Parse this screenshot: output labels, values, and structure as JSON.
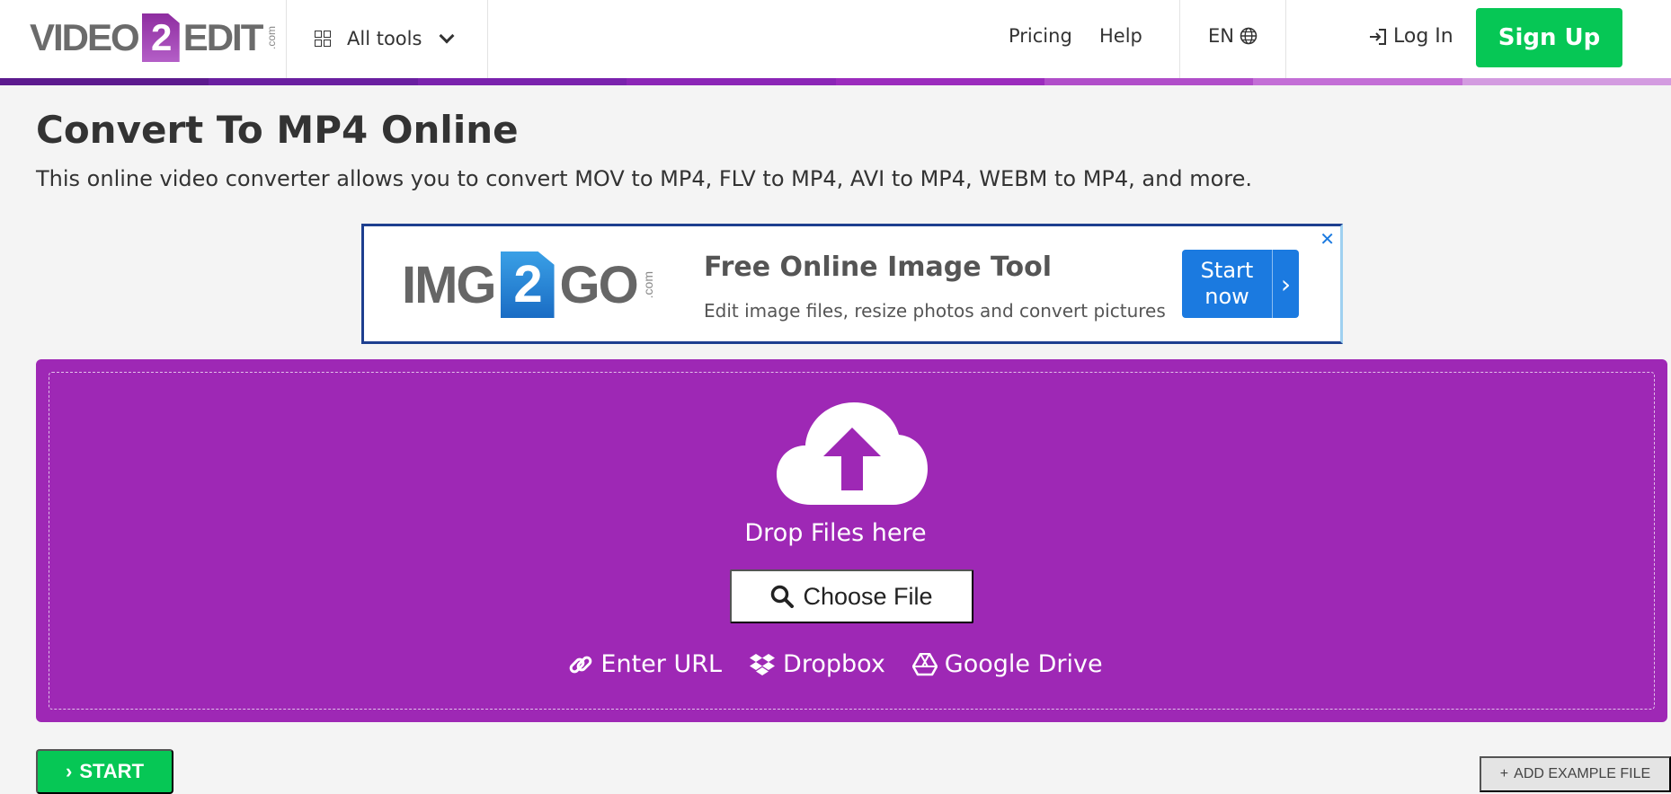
{
  "header": {
    "logo": {
      "left": "VIDEO",
      "two": "2",
      "right": "EDIT",
      "com": ".com"
    },
    "all_tools": "All tools",
    "pricing": "Pricing",
    "help": "Help",
    "lang": "EN",
    "login": "Log In",
    "signup": "Sign Up"
  },
  "page": {
    "title": "Convert To MP4 Online",
    "subtitle": "This online video converter allows you to convert MOV to MP4, FLV to MP4, AVI to MP4, WEBM to MP4, and more."
  },
  "ad": {
    "logo": {
      "left": "IMG",
      "two": "2",
      "right": "GO",
      "com": ".com"
    },
    "heading": "Free Online Image Tool",
    "text": "Edit image files, resize photos and convert pictures",
    "button": "Start now",
    "close": "✕"
  },
  "dropzone": {
    "drop_text": "Drop Files here",
    "choose_file": "Choose File",
    "sources": {
      "url": "Enter URL",
      "dropbox": "Dropbox",
      "gdrive": "Google Drive"
    }
  },
  "bottom": {
    "start": "START",
    "add_example": "ADD EXAMPLE FILE"
  },
  "colors": {
    "brand_purple": "#9e28b5",
    "green": "#06c755",
    "ad_blue": "#1b7ae0",
    "stripe": [
      "#5c1a8e",
      "#6a1fa0",
      "#7a22ad",
      "#8b25b6",
      "#9b2bbd",
      "#b04dc9",
      "#c36ed6",
      "#d39be0"
    ]
  },
  "icons": {
    "menu": "grid-icon",
    "dropdown": "chevron-down-icon",
    "language": "globe-icon",
    "login": "login-icon",
    "upload": "cloud-upload-icon",
    "search": "search-icon",
    "link": "link-icon",
    "dropbox": "dropbox-icon",
    "gdrive": "google-drive-icon"
  }
}
